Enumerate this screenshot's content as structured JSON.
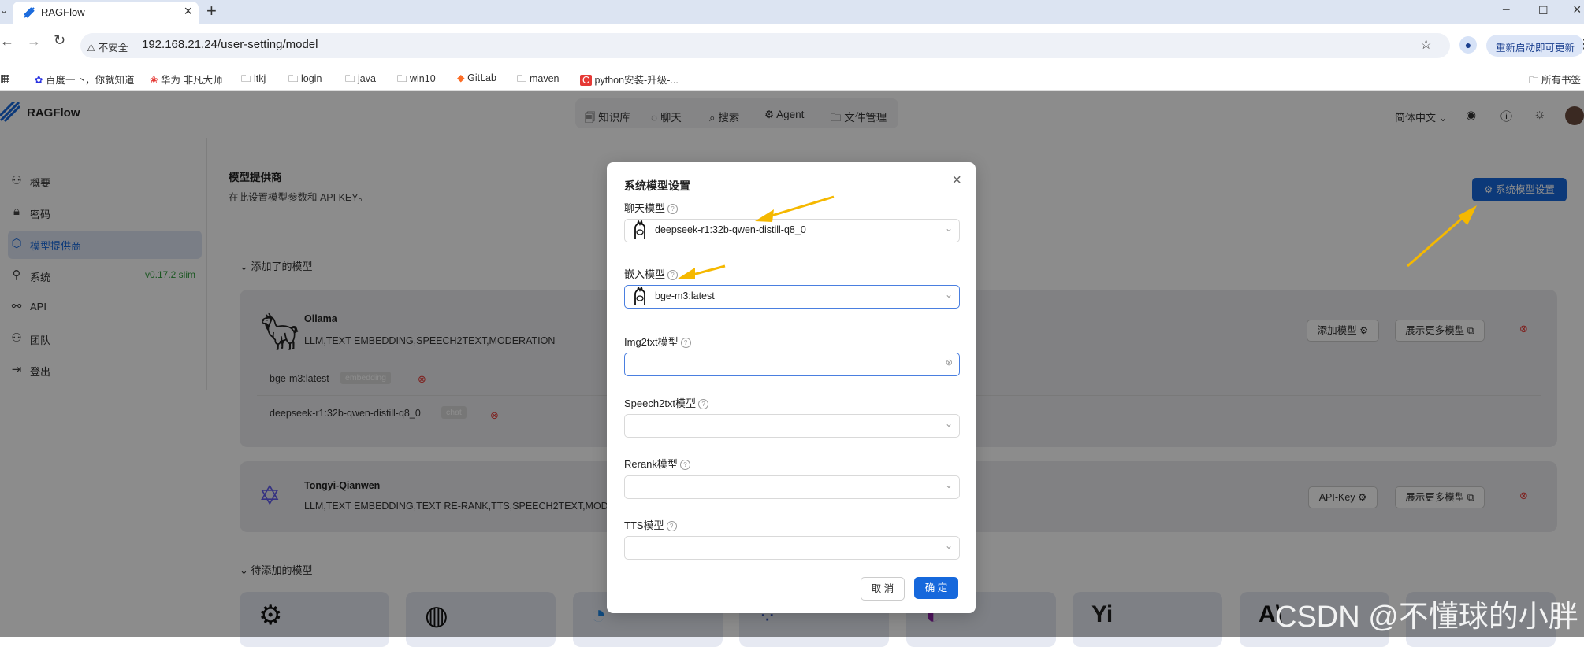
{
  "browser": {
    "tab_title": "RAGFlow",
    "insecure_label": "不安全",
    "url": "192.168.21.24/user-setting/model",
    "restart_label": "重新启动即可更新",
    "all_bookmarks": "所有书签",
    "bookmarks": [
      "百度一下，你就知道",
      "华为 非凡大师",
      "ltkj",
      "login",
      "java",
      "win10",
      "GitLab",
      "maven",
      "python安装-升级-..."
    ]
  },
  "app": {
    "brand": "RAGFlow",
    "nav": [
      "知识库",
      "聊天",
      "搜索",
      "Agent",
      "文件管理"
    ],
    "language": "简体中文"
  },
  "sidebar": {
    "items": [
      {
        "label": "概要",
        "icon": "user-icon"
      },
      {
        "label": "密码",
        "icon": "lock-icon"
      },
      {
        "label": "模型提供商",
        "icon": "model-icon"
      },
      {
        "label": "系统",
        "icon": "system-icon"
      },
      {
        "label": "API",
        "icon": "api-icon"
      },
      {
        "label": "团队",
        "icon": "team-icon"
      },
      {
        "label": "登出",
        "icon": "logout-icon"
      }
    ],
    "version": "v0.17.2 slim"
  },
  "main": {
    "title": "模型提供商",
    "subtitle": "在此设置模型参数和 API KEY。",
    "system_model_button": "系统模型设置",
    "added_section": "添加了的模型",
    "pending_section": "待添加的模型",
    "providers": [
      {
        "name": "Ollama",
        "types": "LLM,TEXT EMBEDDING,SPEECH2TEXT,MODERATION",
        "action_label": "添加模型",
        "more_label": "展示更多模型",
        "models": [
          {
            "name": "bge-m3:latest",
            "tag": "embedding"
          },
          {
            "name": "deepseek-r1:32b-qwen-distill-q8_0",
            "tag": "chat"
          }
        ]
      },
      {
        "name": "Tongyi-Qianwen",
        "types": "LLM,TEXT EMBEDDING,TEXT RE-RANK,TTS,SPEECH2TEXT,MODERATION",
        "action_label": "API-Key",
        "more_label": "展示更多模型"
      }
    ]
  },
  "modal": {
    "title": "系统模型设置",
    "fields": [
      {
        "label": "聊天模型",
        "value": "deepseek-r1:32b-qwen-distill-q8_0"
      },
      {
        "label": "嵌入模型",
        "value": "bge-m3:latest"
      },
      {
        "label": "Img2txt模型",
        "value": ""
      },
      {
        "label": "Speech2txt模型",
        "value": ""
      },
      {
        "label": "Rerank模型",
        "value": ""
      },
      {
        "label": "TTS模型",
        "value": ""
      }
    ],
    "cancel_label": "取 消",
    "ok_label": "确 定"
  },
  "watermark": "CSDN @不懂球的小胖",
  "colors": {
    "primary": "#1668dc",
    "annotation_arrow": "#f5b800",
    "delete": "#e53935"
  }
}
